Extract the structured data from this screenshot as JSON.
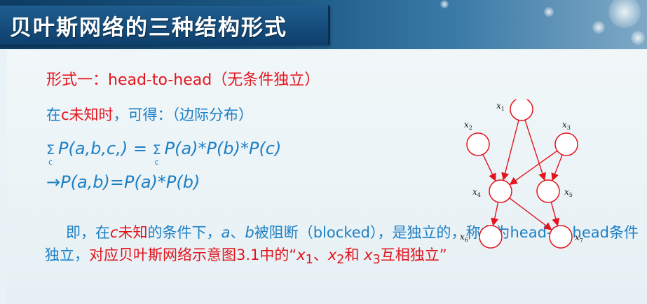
{
  "slide": {
    "title": "贝叶斯网络的三种结构形式"
  },
  "content": {
    "form_heading": "形式一：head-to-head（无条件独立）",
    "condition_line_blue1": "在",
    "condition_line_red": "c未知时",
    "condition_line_blue2": "，可得：（边际分布）",
    "eq1": {
      "sum_symbol": "Σ",
      "sum_sub": "c",
      "lhs": "P(a,b,c,)",
      "equals": "=",
      "rhs": "P(a)*P(b)*P(c)"
    },
    "eq2": {
      "arrow": "→",
      "text": "P(a,b)=P(a)*P(b)"
    },
    "paragraph": {
      "p1": "即，在",
      "c_red": "c",
      "p2": "未知",
      "p3": "的条件下，",
      "a_i": "a",
      "p4": "、",
      "b_i": "b",
      "p5": "被阻断（blocked），是独立的，称之为head-to-head条件独立，",
      "p6_red": "对应贝叶斯网络示意图3.1中的“",
      "x1": "x",
      "x1_sub": "1",
      "sep1": "、",
      "x2": "x",
      "x2_sub": "2",
      "and": "和 ",
      "x3": "x",
      "x3_sub": "3",
      "end": "互相独立”"
    }
  },
  "graph": {
    "node_color": "#e2141d",
    "nodes": [
      {
        "id": "x1",
        "label": "x",
        "sub": "1"
      },
      {
        "id": "x2",
        "label": "x",
        "sub": "2"
      },
      {
        "id": "x3",
        "label": "x",
        "sub": "3"
      },
      {
        "id": "x4",
        "label": "x",
        "sub": "4"
      },
      {
        "id": "x5",
        "label": "x",
        "sub": "5"
      },
      {
        "id": "x6",
        "label": "x",
        "sub": "6"
      },
      {
        "id": "x7",
        "label": "x",
        "sub": "7"
      }
    ]
  }
}
